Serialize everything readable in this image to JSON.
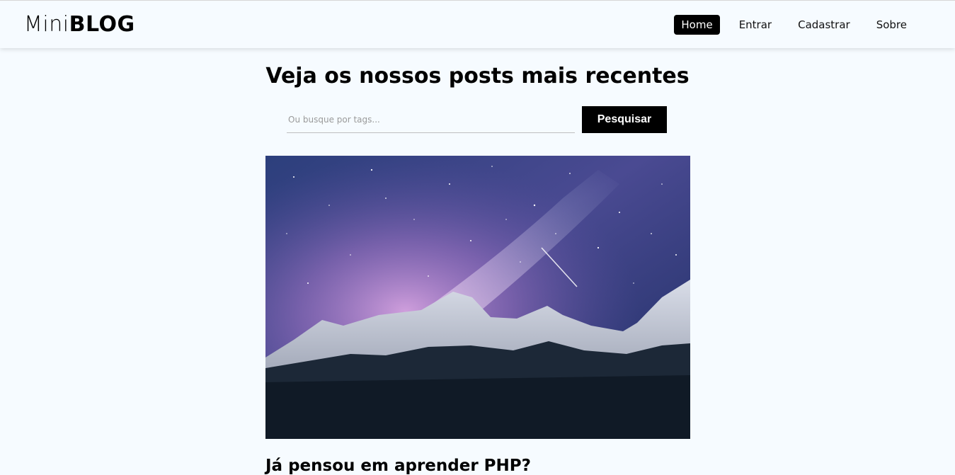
{
  "navbar": {
    "brand_light": "Mini",
    "brand_bold": "BLOG",
    "links": [
      {
        "label": "Home",
        "active": true
      },
      {
        "label": "Entrar",
        "active": false
      },
      {
        "label": "Cadastrar",
        "active": false
      },
      {
        "label": "Sobre",
        "active": false
      }
    ]
  },
  "main": {
    "title": "Veja os nossos posts mais recentes",
    "search": {
      "placeholder": "Ou busque por tags...",
      "button_label": "Pesquisar"
    },
    "posts": [
      {
        "title": "Já pensou em aprender PHP?",
        "image": "mountain-night-sky-image"
      }
    ]
  },
  "colors": {
    "background": "#f6fbff",
    "accent": "#000000",
    "accent_text": "#ffffff"
  }
}
